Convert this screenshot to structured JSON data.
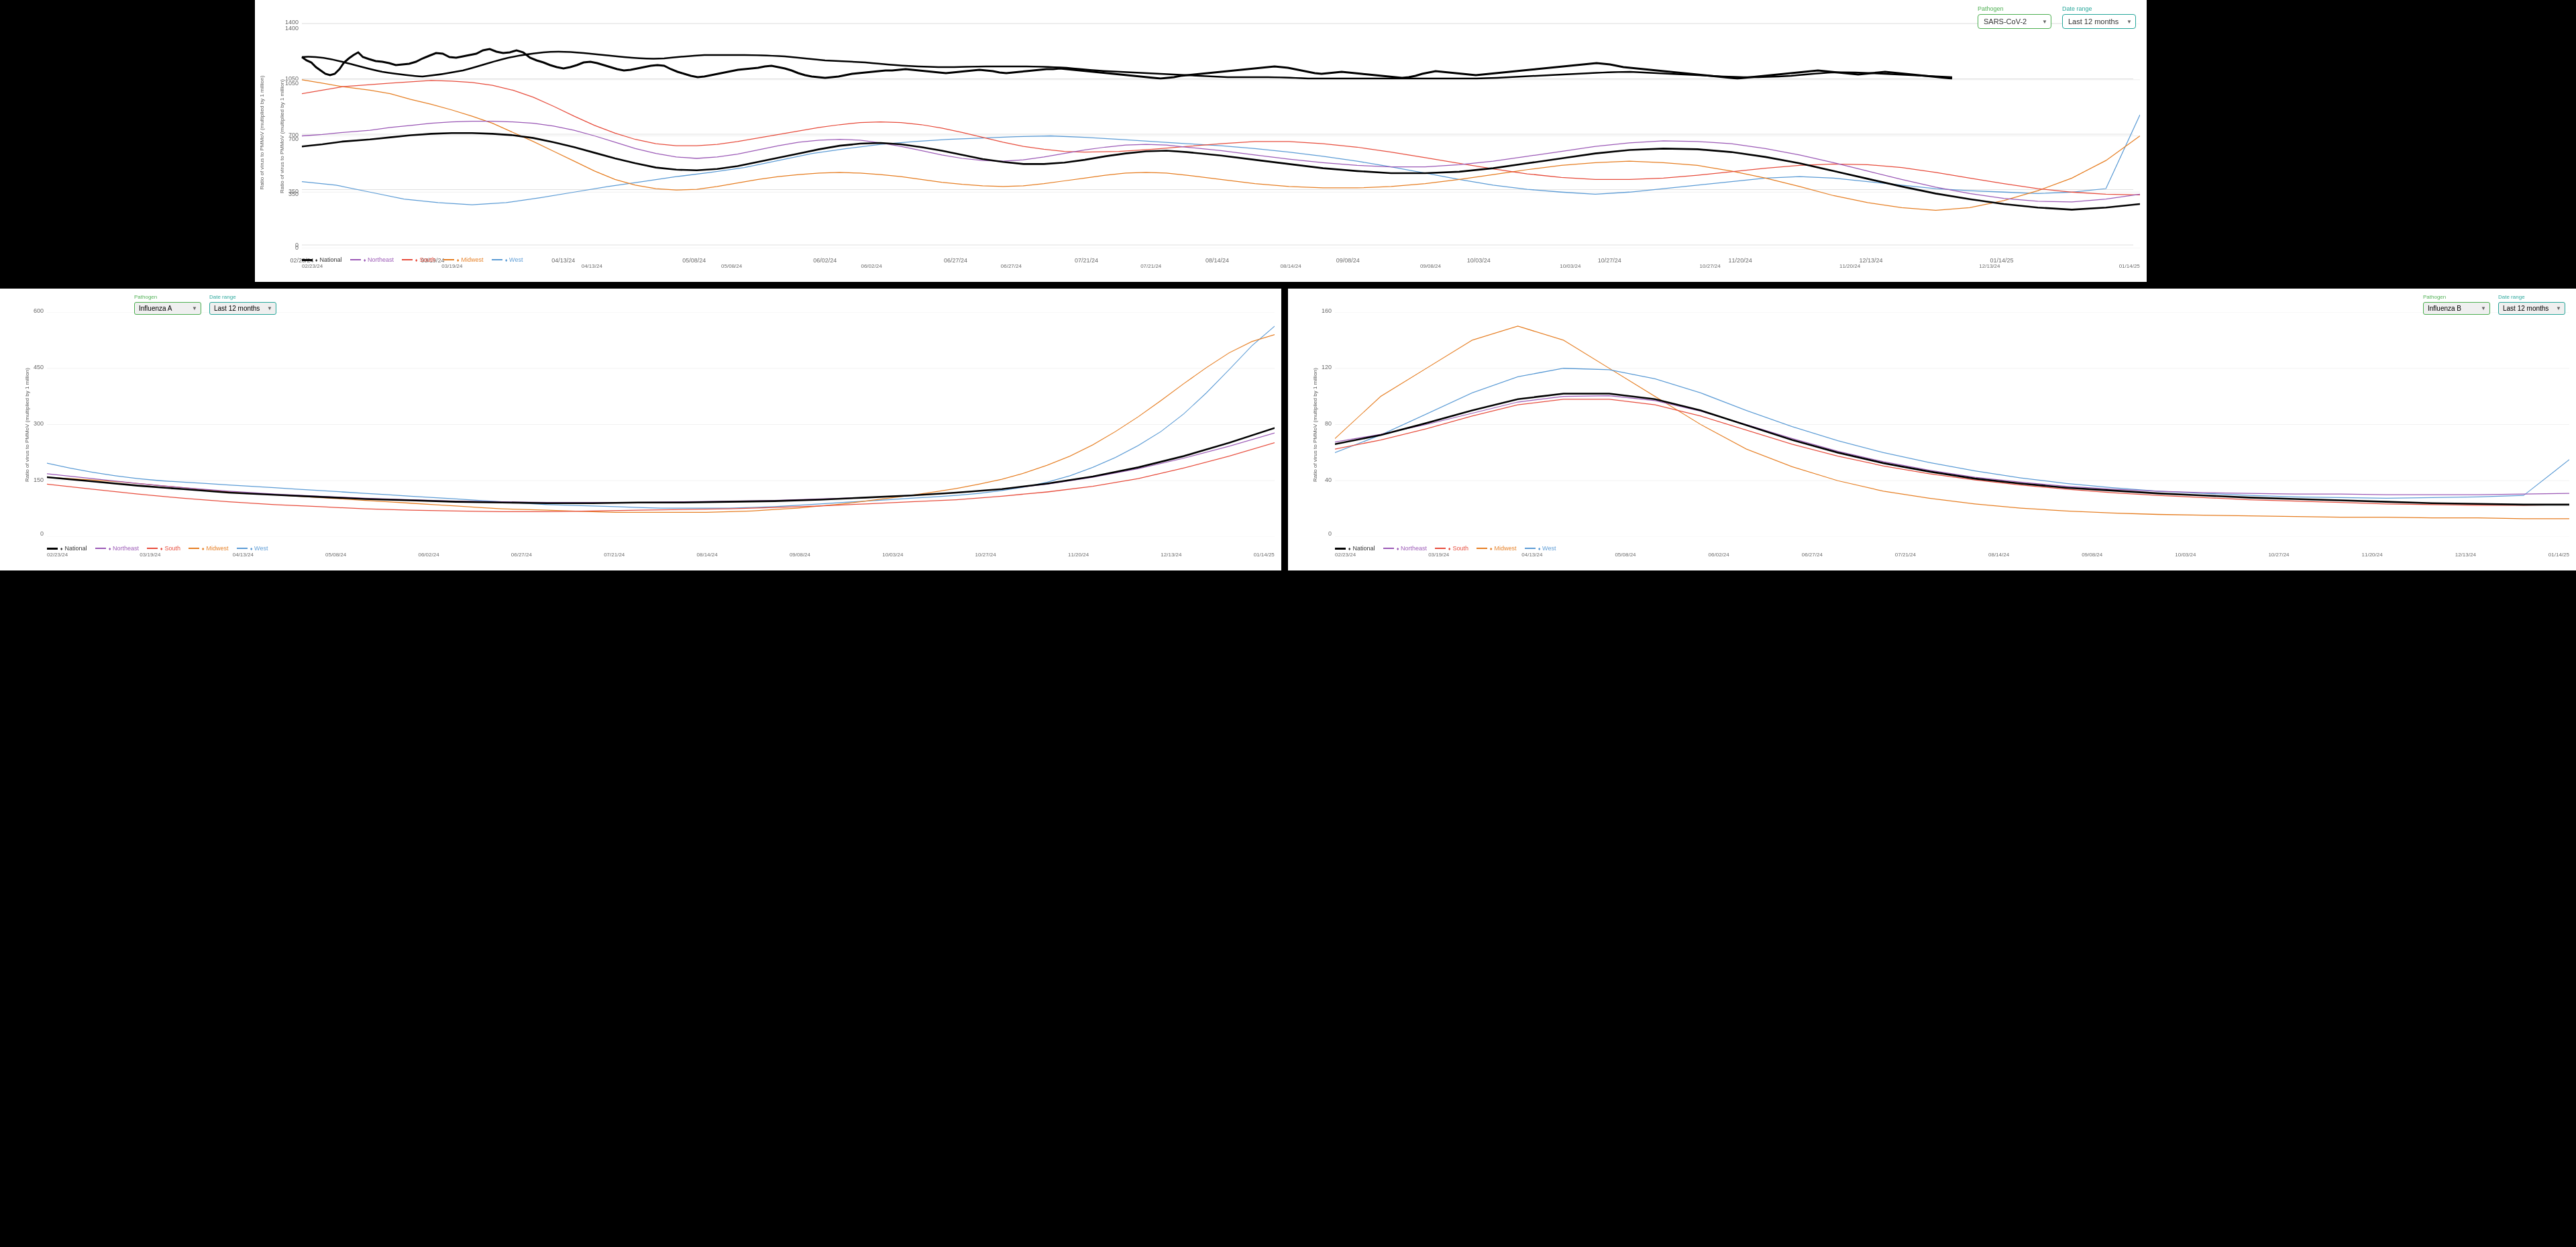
{
  "charts": {
    "top": {
      "pathogen_label": "Pathogen",
      "pathogen_value": "SARS-CoV-2",
      "date_range_label": "Date range",
      "date_range_value": "Last 12 months",
      "y_axis_label": "Ratio of virus to PMMoV (multiplied by 1 million)",
      "y_ticks": [
        "0",
        "350",
        "700",
        "1050",
        "1400"
      ],
      "x_ticks": [
        "02/23/24",
        "03/19/24",
        "04/13/24",
        "05/08/24",
        "06/02/24",
        "06/27/24",
        "07/21/24",
        "08/14/24",
        "09/08/24",
        "10/03/24",
        "10/27/24",
        "11/20/24",
        "12/13/24",
        "01/14/25"
      ],
      "legend": [
        {
          "label": "National",
          "color": "#000000",
          "type": "bold"
        },
        {
          "label": "Northeast",
          "color": "#9b59b6",
          "type": "line"
        },
        {
          "label": "South",
          "color": "#e74c3c",
          "type": "line"
        },
        {
          "label": "Midwest",
          "color": "#e67e22",
          "type": "line"
        },
        {
          "label": "West",
          "color": "#3498db",
          "type": "line"
        }
      ]
    },
    "bottom_left": {
      "pathogen_label": "Pathogen",
      "pathogen_value": "Influenza A",
      "date_range_label": "Date range",
      "date_range_value": "Last 12 months",
      "y_axis_label": "Ratio of virus to PMMoV (multiplied by 1 million)",
      "y_ticks": [
        "0",
        "150",
        "300",
        "450",
        "600"
      ],
      "x_ticks": [
        "02/23/24",
        "03/19/24",
        "04/13/24",
        "05/08/24",
        "06/02/24",
        "06/27/24",
        "07/21/24",
        "08/14/24",
        "09/08/24",
        "10/03/24",
        "10/27/24",
        "11/20/24",
        "12/13/24",
        "01/14/25"
      ],
      "legend": [
        {
          "label": "National",
          "color": "#000000",
          "type": "bold"
        },
        {
          "label": "Northeast",
          "color": "#9b59b6",
          "type": "line"
        },
        {
          "label": "South",
          "color": "#e74c3c",
          "type": "line"
        },
        {
          "label": "Midwest",
          "color": "#e67e22",
          "type": "line"
        },
        {
          "label": "West",
          "color": "#3498db",
          "type": "line"
        }
      ]
    },
    "bottom_right": {
      "pathogen_label": "Pathogen",
      "pathogen_value": "Influenza B",
      "date_range_label": "Date range",
      "date_range_value": "Last 12 months",
      "y_axis_label": "Ratio of virus to PMMoV (multiplied by 1 million)",
      "y_ticks": [
        "0",
        "40",
        "80",
        "120",
        "160"
      ],
      "x_ticks": [
        "02/23/24",
        "03/19/24",
        "04/13/24",
        "05/08/24",
        "06/02/24",
        "06/27/24",
        "07/21/24",
        "08/14/24",
        "09/08/24",
        "10/03/24",
        "10/27/24",
        "11/20/24",
        "12/13/24",
        "01/14/25"
      ],
      "legend": [
        {
          "label": "National",
          "color": "#000000",
          "type": "bold"
        },
        {
          "label": "Northeast",
          "color": "#9b59b6",
          "type": "line"
        },
        {
          "label": "South",
          "color": "#e74c3c",
          "type": "line"
        },
        {
          "label": "Midwest",
          "color": "#e67e22",
          "type": "line"
        },
        {
          "label": "West",
          "color": "#3498db",
          "type": "line"
        }
      ]
    }
  },
  "icons": {
    "dropdown_arrow": "▼"
  }
}
